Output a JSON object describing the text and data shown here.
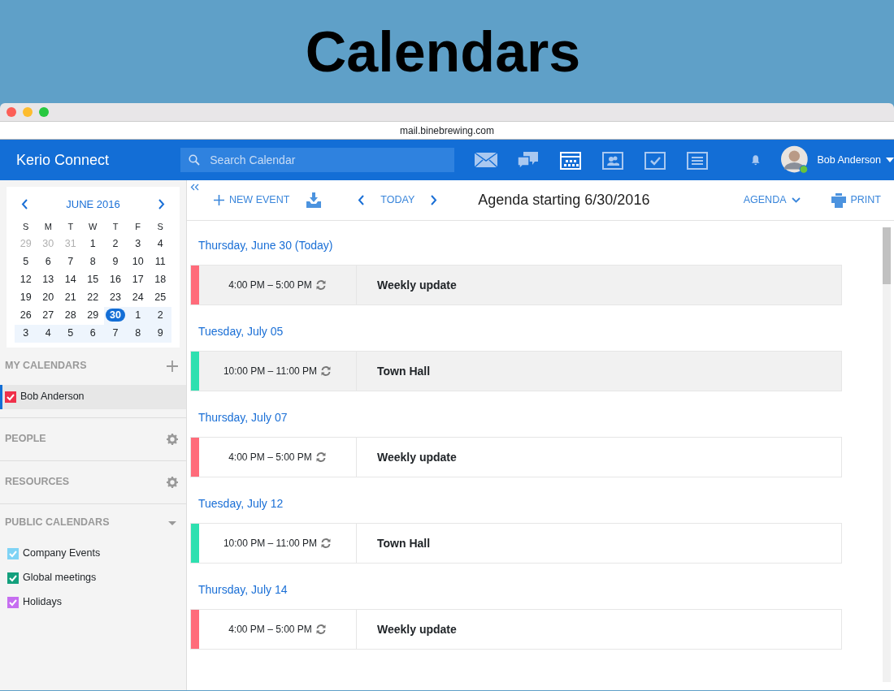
{
  "banner": {
    "title": "Calendars"
  },
  "browser": {
    "url": "mail.binebrewing.com"
  },
  "app": {
    "brand": "Kerio Connect",
    "search": {
      "placeholder": "Search Calendar"
    },
    "apps": [
      {
        "kind": "mail",
        "selected": false
      },
      {
        "kind": "chat",
        "selected": false
      },
      {
        "kind": "calendar",
        "selected": true
      },
      {
        "kind": "contacts",
        "selected": false
      },
      {
        "kind": "tasks",
        "selected": false
      },
      {
        "kind": "notes",
        "selected": false
      }
    ],
    "user": "Bob Anderson"
  },
  "mini_calendar": {
    "month": "JUNE 2016",
    "weekdays": [
      "S",
      "M",
      "T",
      "W",
      "T",
      "F",
      "S"
    ],
    "weeks": [
      [
        {
          "day": "29",
          "muted": true
        },
        {
          "day": "30",
          "muted": true
        },
        {
          "day": "31",
          "muted": true
        },
        {
          "day": "1"
        },
        {
          "day": "2"
        },
        {
          "day": "3"
        },
        {
          "day": "4"
        }
      ],
      [
        {
          "day": "5"
        },
        {
          "day": "6"
        },
        {
          "day": "7"
        },
        {
          "day": "8"
        },
        {
          "day": "9"
        },
        {
          "day": "10"
        },
        {
          "day": "11"
        }
      ],
      [
        {
          "day": "12"
        },
        {
          "day": "13"
        },
        {
          "day": "14"
        },
        {
          "day": "15"
        },
        {
          "day": "16"
        },
        {
          "day": "17"
        },
        {
          "day": "18"
        }
      ],
      [
        {
          "day": "19"
        },
        {
          "day": "20"
        },
        {
          "day": "21"
        },
        {
          "day": "22"
        },
        {
          "day": "23"
        },
        {
          "day": "24"
        },
        {
          "day": "25"
        }
      ],
      [
        {
          "day": "26"
        },
        {
          "day": "27"
        },
        {
          "day": "28"
        },
        {
          "day": "29"
        },
        {
          "day": "30",
          "selected": true,
          "in_range": true
        },
        {
          "day": "1",
          "in_range": true
        },
        {
          "day": "2",
          "in_range": true
        }
      ],
      [
        {
          "day": "3",
          "in_range": true
        },
        {
          "day": "4",
          "in_range": true
        },
        {
          "day": "5",
          "in_range": true
        },
        {
          "day": "6",
          "in_range": true
        },
        {
          "day": "7",
          "in_range": true
        },
        {
          "day": "8",
          "in_range": true
        },
        {
          "day": "9",
          "in_range": true
        }
      ]
    ]
  },
  "sections": [
    {
      "title": "MY CALENDARS",
      "kind": "add",
      "items": [
        {
          "label": "Bob Anderson",
          "checked": true,
          "selected": true,
          "color": "#f0304a"
        }
      ]
    },
    {
      "title": "PEOPLE",
      "kind": "settings"
    },
    {
      "title": "RESOURCES",
      "kind": "settings"
    },
    {
      "title": "PUBLIC CALENDARS",
      "kind": "dropdown",
      "items": [
        {
          "label": "Company Events",
          "checked": true,
          "selected": false,
          "color": "#7fd3f5"
        },
        {
          "label": "Global meetings",
          "checked": true,
          "selected": false,
          "color": "#13a07d"
        },
        {
          "label": "Holidays",
          "checked": true,
          "selected": false,
          "color": "#c66ef0"
        }
      ]
    }
  ],
  "toolbar": {
    "new_event": "NEW EVENT",
    "today": "TODAY",
    "title": "Agenda starting 6/30/2016",
    "view": "AGENDA",
    "print": "PRINT"
  },
  "agenda": [
    {
      "date": "Thursday, June 30 (Today)",
      "events": [
        {
          "time": "4:00 PM – 5:00 PM",
          "title": "Weekly update",
          "recurring": true,
          "selected": true,
          "color": "#ff6b7a"
        }
      ]
    },
    {
      "date": "Tuesday, July 05",
      "events": [
        {
          "time": "10:00 PM – 11:00 PM",
          "title": "Town Hall",
          "recurring": true,
          "selected": true,
          "color": "#2ee0b0"
        }
      ]
    },
    {
      "date": "Thursday, July 07",
      "events": [
        {
          "time": "4:00 PM – 5:00 PM",
          "title": "Weekly update",
          "recurring": true,
          "selected": false,
          "color": "#ff6b7a"
        }
      ]
    },
    {
      "date": "Tuesday, July 12",
      "events": [
        {
          "time": "10:00 PM – 11:00 PM",
          "title": "Town Hall",
          "recurring": true,
          "selected": false,
          "color": "#2ee0b0"
        }
      ]
    },
    {
      "date": "Thursday, July 14",
      "events": [
        {
          "time": "4:00 PM – 5:00 PM",
          "title": "Weekly update",
          "recurring": true,
          "selected": false,
          "color": "#ff6b7a"
        }
      ]
    }
  ]
}
